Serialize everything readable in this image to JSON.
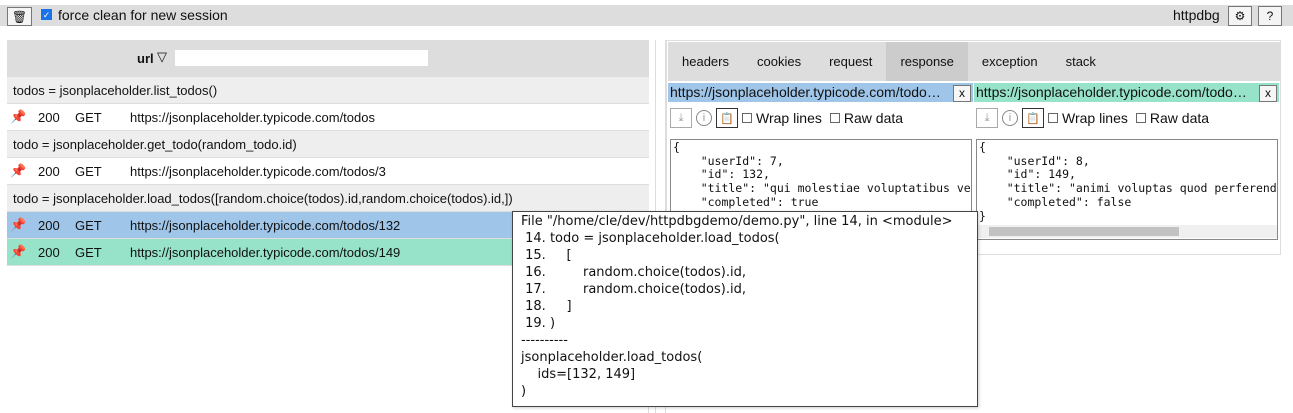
{
  "topbar": {
    "force_clean_label": "force clean for new session",
    "force_clean_checked": true,
    "app_name": "httpdbg",
    "icons": [
      "trash-icon",
      "settings-icon",
      "help-icon"
    ]
  },
  "list": {
    "filter_label": "url",
    "filter_value": "",
    "groups": [
      {
        "label": "todos = jsonplaceholder.list_todos()",
        "requests": [
          {
            "status": "200",
            "method": "GET",
            "url": "https://jsonplaceholder.typicode.com/todos"
          }
        ]
      },
      {
        "label": "todo = jsonplaceholder.get_todo(random_todo.id)",
        "requests": [
          {
            "status": "200",
            "method": "GET",
            "url": "https://jsonplaceholder.typicode.com/todos/3"
          }
        ]
      },
      {
        "label": "todo = jsonplaceholder.load_todos([random.choice(todos).id,random.choice(todos).id,])",
        "requests": [
          {
            "status": "200",
            "method": "GET",
            "url": "https://jsonplaceholder.typicode.com/todos/132",
            "color": "#9fc5e8"
          },
          {
            "status": "200",
            "method": "GET",
            "url": "https://jsonplaceholder.typicode.com/todos/149",
            "color": "#96e3c9"
          }
        ]
      }
    ]
  },
  "details": {
    "tabs": [
      "headers",
      "cookies",
      "request",
      "response",
      "exception",
      "stack"
    ],
    "active_tab": "response",
    "panes": [
      {
        "url": "https://jsonplaceholder.typicode.com/todo…",
        "close": "x",
        "wrap_label": "Wrap lines",
        "raw_label": "Raw data",
        "color": "#9fc5e8",
        "body": "{\n    \"userId\": 7,\n    \"id\": 132,\n    \"title\": \"qui molestiae voluptatibus velit\",\n    \"completed\": true\n}"
      },
      {
        "url": "https://jsonplaceholder.typicode.com/todo…",
        "close": "x",
        "wrap_label": "Wrap lines",
        "raw_label": "Raw data",
        "color": "#96e3c9",
        "body": "{\n    \"userId\": 8,\n    \"id\": 149,\n    \"title\": \"animi voluptas quod perferendis\",\n    \"completed\": false\n}"
      }
    ]
  },
  "tooltip": {
    "text": "File \"/home/cle/dev/httpdbgdemo/demo.py\", line 14, in <module>\n 14. todo = jsonplaceholder.load_todos(\n 15.     [\n 16.         random.choice(todos).id,\n 17.         random.choice(todos).id,\n 18.     ]\n 19. )\n----------\njsonplaceholder.load_todos(\n    ids=[132, 149]\n)"
  }
}
